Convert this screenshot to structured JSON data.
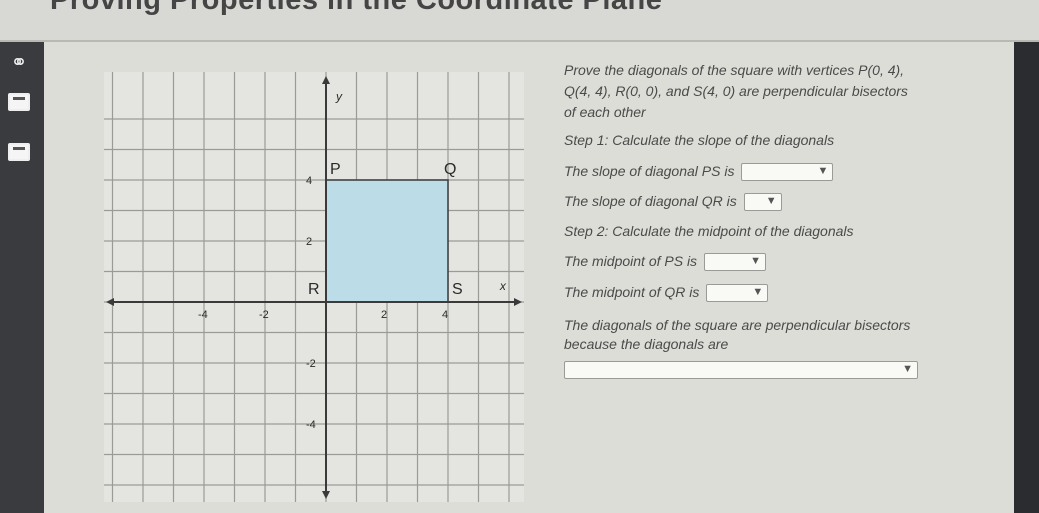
{
  "page": {
    "title": "Proving Properties in the Coordinate Plane"
  },
  "rail": {
    "icons": [
      "headphones-icon",
      "calculator-icon",
      "calculator-icon"
    ]
  },
  "graph": {
    "axis_x_label": "x",
    "axis_y_label": "y",
    "x_ticks": [
      "-4",
      "-2",
      "2",
      "4"
    ],
    "y_ticks": [
      "4",
      "2",
      "-2",
      "-4"
    ],
    "points": [
      {
        "label": "P",
        "x": 0,
        "y": 4
      },
      {
        "label": "Q",
        "x": 4,
        "y": 4
      },
      {
        "label": "R",
        "x": 0,
        "y": 0
      },
      {
        "label": "S",
        "x": 4,
        "y": 0
      }
    ],
    "square_fill": "#bcdce7",
    "square_stroke": "#3a3a3a"
  },
  "problem": {
    "prompt_line1": "Prove the diagonals of the square with vertices P(0, 4),",
    "prompt_line2": "Q(4, 4), R(0, 0), and S(4, 0) are perpendicular bisectors",
    "prompt_line3": "of each other",
    "step1": "Step 1: Calculate the slope of the diagonals",
    "slope_ps": "The slope of diagonal PS is",
    "slope_qr": "The slope of diagonal QR is",
    "step2": "Step 2: Calculate the midpoint of the diagonals",
    "midpoint_ps": "The midpoint of PS is",
    "midpoint_qr": "The midpoint of QR is",
    "conclusion_line1": "The diagonals of the square are perpendicular bisectors",
    "conclusion_line2": "because the diagonals are",
    "dropdown_value": ""
  }
}
